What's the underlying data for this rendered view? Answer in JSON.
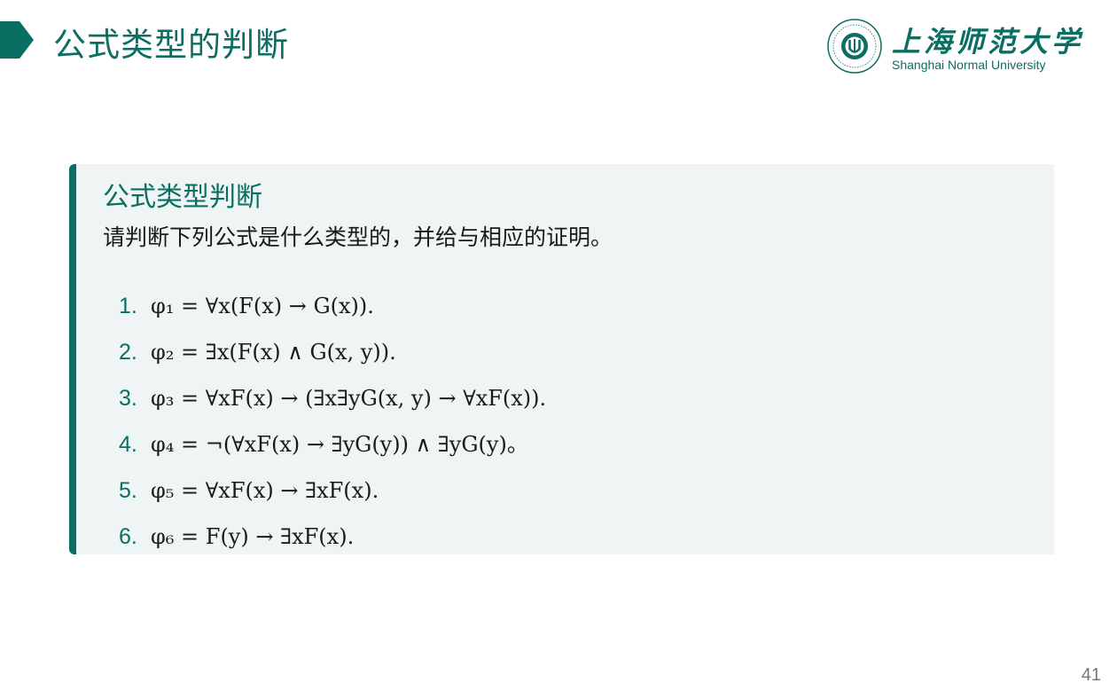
{
  "header": {
    "title": "公式类型的判断"
  },
  "logo": {
    "name_cn": "上海师范大学",
    "name_en": "Shanghai Normal University"
  },
  "block": {
    "title": "公式类型判断",
    "intro": "请判断下列公式是什么类型的，并给与相应的证明。",
    "items": [
      {
        "num": "1.",
        "formula": "φ₁ = ∀x(F(x) → G(x))."
      },
      {
        "num": "2.",
        "formula": "φ₂ = ∃x(F(x) ∧ G(x, y))."
      },
      {
        "num": "3.",
        "formula": "φ₃ = ∀xF(x) → (∃x∃yG(x, y) → ∀xF(x))."
      },
      {
        "num": "4.",
        "formula": "φ₄ = ¬(∀xF(x) → ∃yG(y)) ∧ ∃yG(y)。"
      },
      {
        "num": "5.",
        "formula": "φ₅ = ∀xF(x) → ∃xF(x)."
      },
      {
        "num": "6.",
        "formula": "φ₆ = F(y) → ∃xF(x)."
      }
    ]
  },
  "footer": {
    "page_number": "41"
  },
  "colors": {
    "accent": "#0b6e62",
    "block_bg": "#eef5f4",
    "text": "#1a1a1a"
  }
}
